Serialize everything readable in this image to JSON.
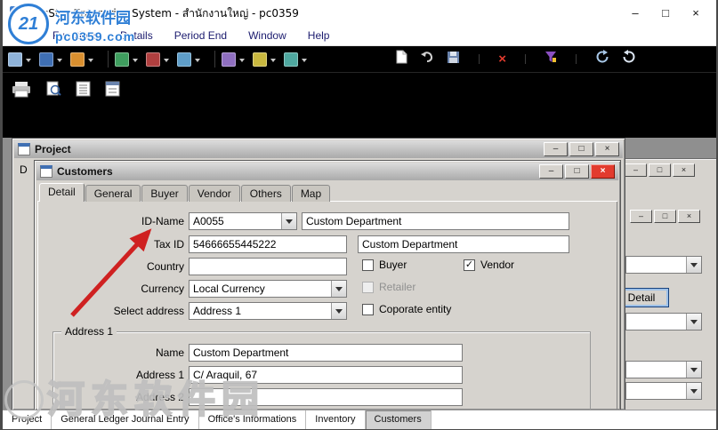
{
  "titlebar": {
    "title": "AccStar Enterprise System - สำนักงานใหญ่ - pc0359"
  },
  "glyphs": {
    "minimize": "–",
    "maximize": "□",
    "close": "×",
    "delete": "×",
    "check": "✓"
  },
  "menubar": {
    "items": [
      "Functions",
      "Details",
      "Period End",
      "Window",
      "Help"
    ]
  },
  "toolbar": {
    "dropdown_icon_names": [
      "company",
      "ledger",
      "display",
      "documents",
      "transactions",
      "reports",
      "lookup",
      "tools",
      "settings"
    ],
    "action_icon_names": [
      "new-document",
      "undo",
      "save",
      "delete",
      "filter",
      "refresh",
      "sync"
    ],
    "secondary_icon_names": [
      "print",
      "print-preview",
      "document-columns",
      "document-form"
    ]
  },
  "watermark": {
    "badge": "21",
    "site_name": "河东软件园",
    "site_url": "pc0359.com"
  },
  "workspace": {
    "project_window": {
      "title": "Project",
      "fragment_label": "D"
    },
    "background_window": {
      "detail_button_label": "Detail"
    },
    "customers_window": {
      "title": "Customers",
      "tabs": [
        "Detail",
        "General",
        "Buyer",
        "Vendor",
        "Others",
        "Map"
      ],
      "selected_tab": "Detail",
      "form": {
        "id_name": {
          "label": "ID-Name",
          "code": "A0055",
          "name": "Custom Department"
        },
        "tax_id": {
          "label": "Tax ID",
          "value": "54666655445222",
          "secondary": "Custom Department"
        },
        "country": {
          "label": "Country",
          "value": ""
        },
        "currency": {
          "label": "Currency",
          "value": "Local Currency"
        },
        "select_address": {
          "label": "Select address",
          "value": "Address 1"
        },
        "checkboxes": {
          "buyer": {
            "label": "Buyer",
            "checked": false
          },
          "vendor": {
            "label": "Vendor",
            "checked": true
          },
          "retailer": {
            "label": "Retailer",
            "checked": false,
            "disabled": true
          },
          "corporate": {
            "label": "Coporate entity",
            "checked": false
          }
        },
        "address_group": {
          "title": "Address 1",
          "name": {
            "label": "Name",
            "value": "Custom Department"
          },
          "address1": {
            "label": "Address 1",
            "value": "C/ Araquil, 67"
          },
          "address2": {
            "label": "Address 2",
            "value": ""
          }
        }
      }
    }
  },
  "bottom_tabs": {
    "items": [
      "Project",
      "General Ledger Journal Entry",
      "Office's Informations",
      "Inventory",
      "Customers"
    ],
    "selected": "Customers"
  },
  "colors": {
    "toolbar_bg": "#000000",
    "workspace_bg": "#8f8f8f",
    "window_chrome": "#d6d3ce",
    "menu_text": "#1b1b6e",
    "close_button_red": "#e23b2e",
    "annotation_arrow": "#cf2121",
    "watermark_blue": "#2f7fd6",
    "focus_border_blue": "#3c7fb1"
  }
}
